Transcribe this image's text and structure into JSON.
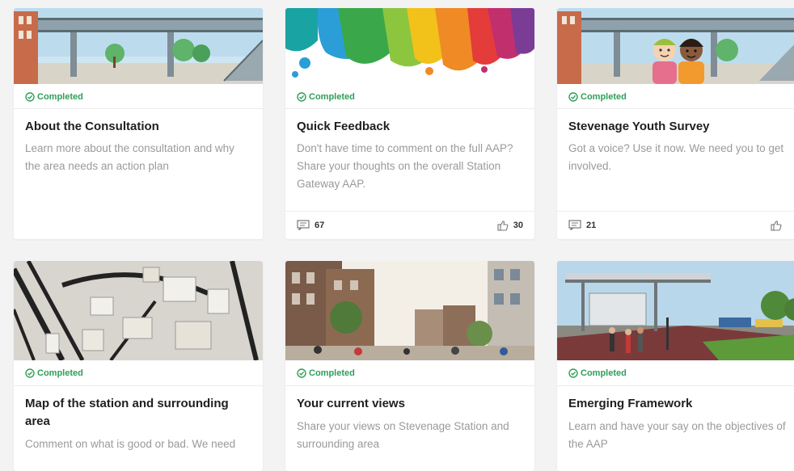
{
  "cards": [
    {
      "status": "Completed",
      "title": "About the Consultation",
      "description": "Learn more about the consultation and why the area needs an action plan"
    },
    {
      "status": "Completed",
      "title": "Quick Feedback",
      "description": "Don't have time to comment on the full AAP? Share your thoughts on the overall Station Gateway AAP.",
      "comments": "67",
      "likes": "30"
    },
    {
      "status": "Completed",
      "title": "Stevenage Youth Survey",
      "description": "Got a voice? Use it now. We need you to get involved.",
      "comments": "21",
      "likes": ""
    },
    {
      "status": "Completed",
      "title": "Map of the station and surrounding area",
      "description": "Comment on what is good or bad. We need"
    },
    {
      "status": "Completed",
      "title": "Your current views",
      "description": "Share your views on Stevenage Station and surrounding area"
    },
    {
      "status": "Completed",
      "title": "Emerging Framework",
      "description": "Learn and have your say on the objectives of the AAP"
    }
  ],
  "icons": {
    "status": "check-circle-icon",
    "comments": "comment-icon",
    "likes": "thumbs-up-icon"
  },
  "colors": {
    "completed": "#2e9e59",
    "page_bg": "#f3f3f4"
  }
}
